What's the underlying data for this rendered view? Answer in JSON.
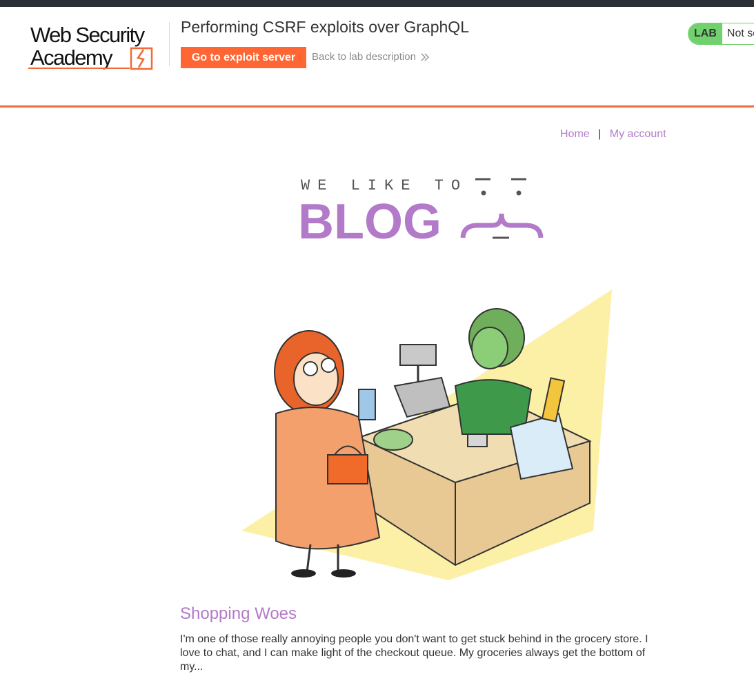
{
  "header": {
    "logo_line1": "Web Security",
    "logo_line2": "Academy",
    "lab_title": "Performing CSRF exploits over GraphQL",
    "exploit_button": "Go to exploit server",
    "back_link": "Back to lab description",
    "lab_badge": "LAB",
    "lab_status": "Not solved"
  },
  "nav": {
    "home": "Home",
    "separator": "|",
    "account": "My account"
  },
  "blog_banner": {
    "tagline": "WE LIKE TO",
    "word": "BLOG"
  },
  "post": {
    "title": "Shopping Woes",
    "summary": "I'm one of those really annoying people you don't want to get stuck behind in the grocery store. I love to chat, and I can make light of the checkout queue. My groceries always get the bottom of my..."
  },
  "colors": {
    "accent_orange": "#ff6633",
    "header_rule": "#f06a35",
    "blog_purple": "#b27ac8",
    "lab_green": "#70d16d"
  }
}
